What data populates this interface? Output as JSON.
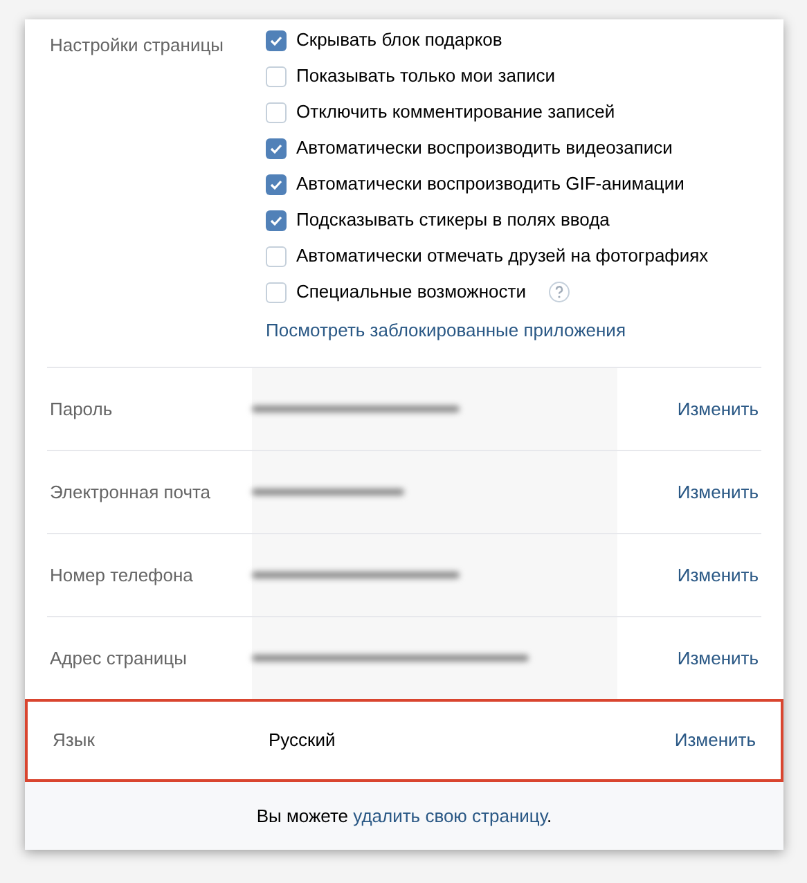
{
  "page_settings": {
    "label": "Настройки страницы",
    "options": [
      {
        "label": "Скрывать блок подарков",
        "checked": true
      },
      {
        "label": "Показывать только мои записи",
        "checked": false
      },
      {
        "label": "Отключить комментирование записей",
        "checked": false
      },
      {
        "label": "Автоматически воспроизводить видеозаписи",
        "checked": true
      },
      {
        "label": "Автоматически воспроизводить GIF-анимации",
        "checked": true
      },
      {
        "label": "Подсказывать стикеры в полях ввода",
        "checked": true
      },
      {
        "label": "Автоматически отмечать друзей на фотографиях",
        "checked": false
      },
      {
        "label": "Специальные возможности",
        "checked": false,
        "help": true
      }
    ],
    "link": "Посмотреть заблокированные приложения"
  },
  "account_rows": [
    {
      "label": "Пароль",
      "kind": "redacted",
      "action": "Изменить",
      "highlighted": false
    },
    {
      "label": "Электронная почта",
      "kind": "redacted",
      "action": "Изменить",
      "highlighted": false
    },
    {
      "label": "Номер телефона",
      "kind": "redacted",
      "action": "Изменить",
      "highlighted": false
    },
    {
      "label": "Адрес страницы",
      "kind": "redacted",
      "action": "Изменить",
      "highlighted": false
    },
    {
      "label": "Язык",
      "kind": "text",
      "value": "Русский",
      "action": "Изменить",
      "highlighted": true
    }
  ],
  "footer": {
    "prefix": "Вы можете",
    "link": "удалить свою страницу",
    "suffix": "."
  }
}
